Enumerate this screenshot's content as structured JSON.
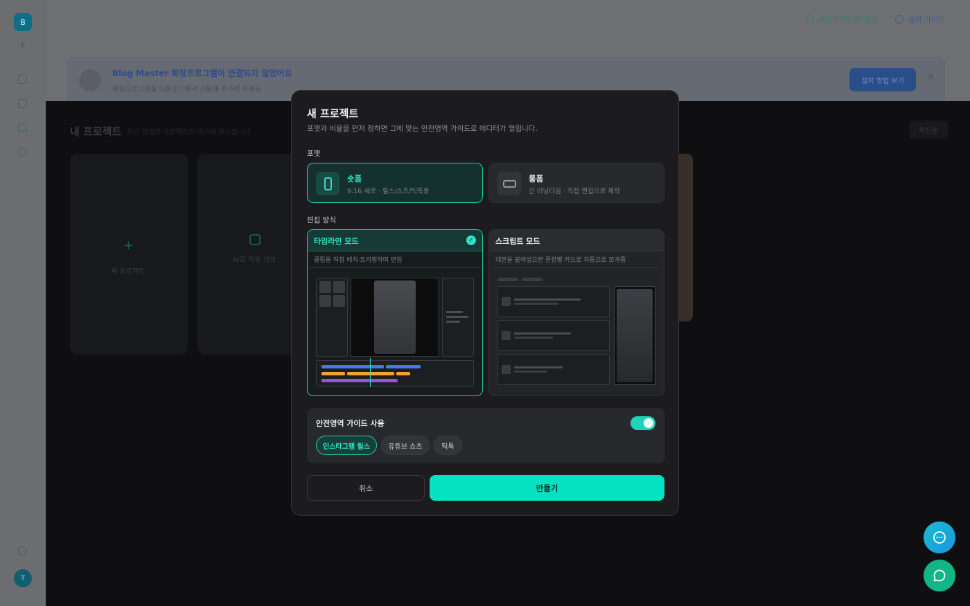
{
  "background": {
    "logo_letter": "B",
    "avatar_letter": "T",
    "top_links": [
      "확장프로그램 연결",
      "설치 가이드"
    ],
    "banner": {
      "title": "Blog Master 확장프로그램이 연결되지 않았어요",
      "subtitle": "확장프로그램을 다운로드해서 크롬에 추가해 주세요.",
      "button": "설치 방법 보기"
    },
    "heading": "내 프로젝트",
    "heading_sub": "최근 작업한 프로젝트가 여기에 표시됩니다",
    "sort_label": "최신순",
    "new_project_label": "새 프로젝트",
    "ai_card_label": "AI로 자동 생성"
  },
  "modal": {
    "title": "새 프로젝트",
    "subtitle": "포맷과 비율을 먼저 정하면 그에 맞는 안전영역 가이드로 에디터가 열립니다.",
    "format_section": "포맷",
    "formats": [
      {
        "name": "숏폼",
        "desc": "9:16 세로 · 릴스/쇼츠/틱톡용",
        "selected": true
      },
      {
        "name": "롱폼",
        "desc": "긴 러닝타임 · 직접 편집으로 제작",
        "selected": false
      }
    ],
    "mode_section": "편집 방식",
    "modes": [
      {
        "name": "타임라인 모드",
        "desc": "클립을 직접 배치·트리밍하며 편집",
        "selected": true
      },
      {
        "name": "스크립트 모드",
        "desc": "대본을 붙여넣으면 문장별 카드로 자동으로 쪼개줌",
        "selected": false
      }
    ],
    "guide": {
      "label": "안전영역 가이드 사용",
      "enabled": true,
      "platforms": [
        {
          "label": "인스타그램 릴스",
          "selected": true
        },
        {
          "label": "유튜브 쇼츠",
          "selected": false
        },
        {
          "label": "틱톡",
          "selected": false
        }
      ]
    },
    "cancel_label": "취소",
    "create_label": "만들기"
  },
  "colors": {
    "accent": "#05e2c2",
    "modal_bg": "#1c1c1f",
    "fab_chat": "#1a93e0",
    "fab_help": "#12b686"
  }
}
